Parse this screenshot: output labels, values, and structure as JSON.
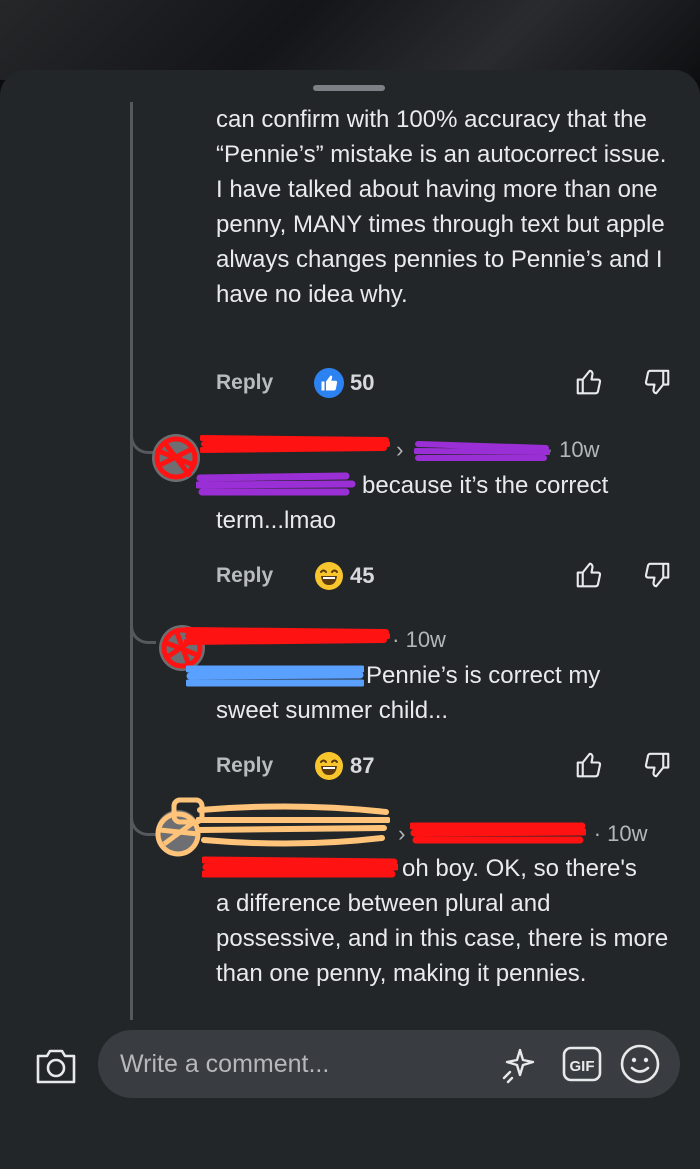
{
  "comment_top": {
    "body": "can confirm with 100% accuracy that the “Pennie’s” mistake is an autocorrect issue. I have talked about having more than one penny, MANY times through text but apple always changes pennies to Pennie’s and I have no idea why.",
    "reply_label": "Reply",
    "reaction_count": "50",
    "reaction_icon": "like-icon"
  },
  "reply_1": {
    "time": "10w",
    "body_line1": "because it’s the correct",
    "body_line2": "term...lmao",
    "reply_label": "Reply",
    "reaction_count": "45",
    "reaction_icon": "laughing-emoji"
  },
  "reply_2": {
    "time": "10w",
    "body_line1": "Pennie’s is correct my",
    "body_line2": "sweet summer child...",
    "reply_label": "Reply",
    "reaction_count": "87",
    "reaction_icon": "laughing-emoji"
  },
  "reply_3": {
    "time": "10w",
    "body_line1": "oh boy. OK, so there's",
    "body_rest": "a difference between plural and possessive, and in this case, there is more than one penny, making it pennies."
  },
  "composer": {
    "placeholder": "Write a comment...",
    "gif_label": "GIF"
  },
  "colors": {
    "sheet_bg": "#232629",
    "link_blue": "#2d82f1",
    "redaction_red": "#ff1212",
    "redaction_purple": "#9b2fd6",
    "redaction_blue": "#5aa0ff",
    "redaction_orange": "#ffc47a"
  }
}
